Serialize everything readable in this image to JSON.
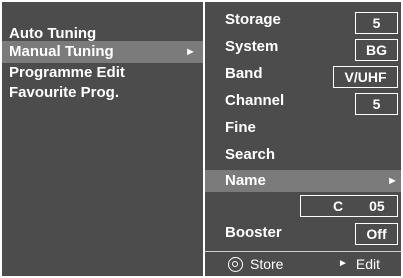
{
  "menu": {
    "items": [
      {
        "label": "Auto Tuning"
      },
      {
        "label": "Manual Tuning",
        "selected": true,
        "arrow": "►"
      },
      {
        "label": "Programme Edit"
      },
      {
        "label": "Favourite Prog."
      }
    ]
  },
  "settings": {
    "storage": {
      "label": "Storage",
      "value": "5"
    },
    "system": {
      "label": "System",
      "value": "BG"
    },
    "band": {
      "label": "Band",
      "value": "V/UHF"
    },
    "channel": {
      "label": "Channel",
      "value": "5"
    },
    "fine": {
      "label": "Fine"
    },
    "search": {
      "label": "Search"
    },
    "name": {
      "label": "Name",
      "arrow": "►",
      "value_letter": "C",
      "value_number": "05"
    },
    "booster": {
      "label": "Booster",
      "value": "Off"
    }
  },
  "footer": {
    "store_label": "Store",
    "edit_arrow": "►",
    "edit_label": "Edit"
  },
  "colors": {
    "panel": "#4c4c4c",
    "highlight": "#7b7b7b",
    "text": "#ffffff",
    "background": "#ffffff"
  }
}
